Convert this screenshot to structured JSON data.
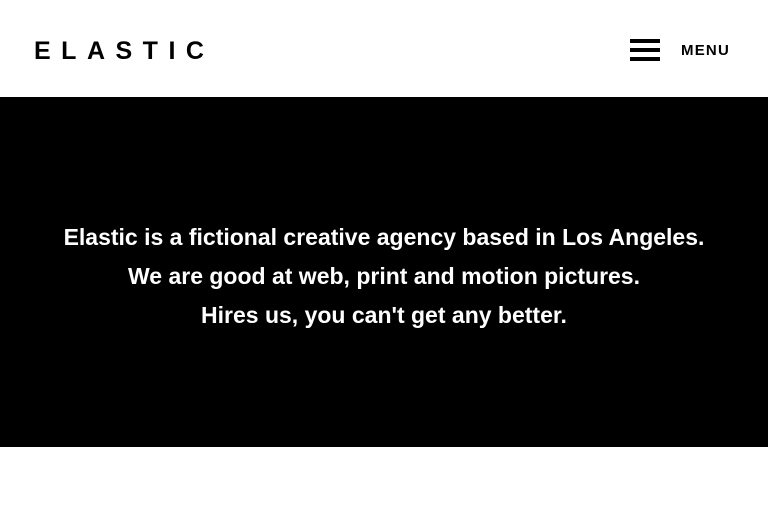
{
  "header": {
    "logo_text": "ELASTIC",
    "menu_label": "MENU",
    "menu_icon": "hamburger-icon"
  },
  "hero": {
    "lines": [
      "Elastic is a fictional creative agency based in Los Angeles.",
      "We are good at web, print and motion pictures.",
      "Hires us, you can't get any better."
    ]
  },
  "colors": {
    "background": "#ffffff",
    "hero_background": "#000000",
    "hero_text": "#ffffff",
    "header_text": "#000000"
  }
}
